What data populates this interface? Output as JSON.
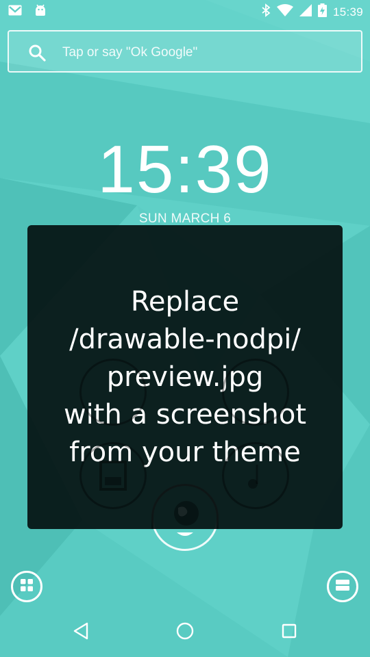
{
  "status_bar": {
    "left_icons": [
      "gmail-icon",
      "android-icon"
    ],
    "right_icons": [
      "bluetooth-icon",
      "wifi-icon",
      "signal-icon",
      "battery-charging-icon"
    ],
    "time": "15:39"
  },
  "search": {
    "placeholder": "Tap or say \"Ok Google\""
  },
  "lockscreen": {
    "clock": "15:39",
    "date": "SUN MARCH 6"
  },
  "overlay": {
    "message": "Replace\n/drawable-nodpi/\npreview.jpg\nwith a screenshot\nfrom your theme"
  },
  "dock": {
    "left_icon": "app-drawer-icon",
    "right_icon": "menu-icon"
  },
  "navigation": {
    "buttons": [
      "back-icon",
      "home-icon",
      "recents-icon"
    ]
  },
  "colors": {
    "wallpaper_teal": "#5ccfc6",
    "overlay": "#051212",
    "foreground": "#ffffff"
  }
}
